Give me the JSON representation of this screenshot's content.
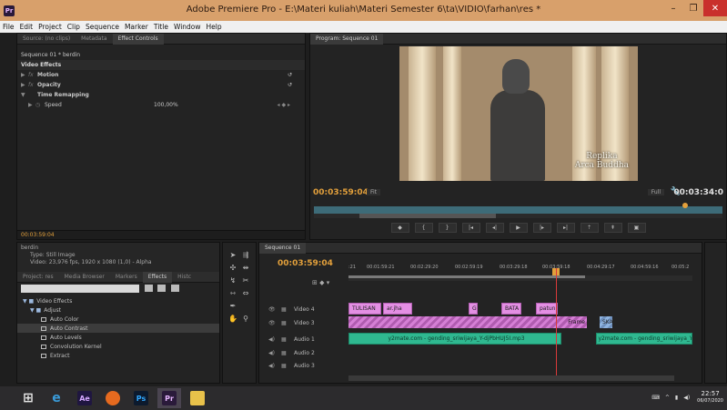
{
  "window": {
    "title": "Adobe Premiere Pro - E:\\Materi kuliah\\Materi Semester 6\\ta\\VIDIO\\farhan\\res *",
    "minimize": "–",
    "maximize": "❐",
    "close": "✕"
  },
  "menu": [
    "File",
    "Edit",
    "Project",
    "Clip",
    "Sequence",
    "Marker",
    "Title",
    "Window",
    "Help"
  ],
  "effect_controls": {
    "tabs": [
      "Source: (no clips)",
      "Metadata",
      "Effect Controls"
    ],
    "sequence_label": "Sequence 01 * berdin",
    "section": "Video Effects",
    "motion": "Motion",
    "opacity": "Opacity",
    "time_remapping": "Time Remapping",
    "speed_label": "Speed",
    "speed_value": "100,00%",
    "timecode": "00:03:59:04"
  },
  "program": {
    "tab": "Program: Sequence 01",
    "caption_line1": "Replika",
    "caption_line2": "Arca Buddha",
    "timecode": "00:03:59:04",
    "duration": "00:03:34:0",
    "fit": "Fit",
    "quality": "Full"
  },
  "project": {
    "clip_name": "berdin",
    "type": "Type: Still Image",
    "video": "Video: 23,976 fps, 1920 x 1080 (1,0) - Alpha",
    "tabs": [
      "Project: res",
      "Media Browser",
      "Markers",
      "Effects",
      "Histc"
    ],
    "tree": [
      "Video Effects",
      "Adjust",
      "Auto Color",
      "Auto Contrast",
      "Auto Levels",
      "Convolution Kernel",
      "Extract"
    ]
  },
  "timeline": {
    "tab": "Sequence 01",
    "timecode": "00:03:59:04",
    "ruler": [
      ":21",
      "00:01:59:21",
      "00:02:29:20",
      "00:02:59:19",
      "00:03:29:18",
      "00:03:59:18",
      "00:04:29:17",
      "00:04:59:16",
      "00:05:2"
    ],
    "tracks": [
      "Video 4",
      "Video 3",
      "Audio 1",
      "Audio 2",
      "Audio 3"
    ],
    "clips": {
      "tulisan": "TULISAN",
      "arjha": "ar.jha",
      "g": "G",
      "bata": "BATA",
      "patun": "patun",
      "frame": "Frame",
      "ska": "SKA",
      "audio1": "y2mate.com - gending_sriwijaya_Y-djPbHUJ5I.mp3",
      "audio2": "y2mate.com - gending_sriwijaya_Y"
    }
  },
  "taskbar": {
    "apps": [
      "Ae",
      "Ps",
      "Pr"
    ],
    "time": "22:57",
    "date": "06/07/2020"
  },
  "colors": {
    "accent_timecode": "#e3a03b",
    "titlebar": "#d8a06b",
    "audio_clip": "#2fb890",
    "video_clip": "#e38fe3"
  }
}
